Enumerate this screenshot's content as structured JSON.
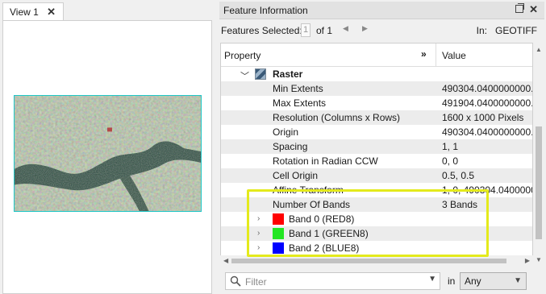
{
  "view": {
    "tab_label": "View 1",
    "close_glyph": "✕"
  },
  "feature_info": {
    "title": "Feature Information",
    "close_glyph": "✕",
    "features_selected_label": "Features Selected:",
    "features_selected_value": "1",
    "of_label": "of 1",
    "in_label": "In:",
    "in_value": "GEOTIFF"
  },
  "table": {
    "col_property": "Property",
    "col_expand": "»",
    "col_value": "Value",
    "group": {
      "label": "Raster"
    },
    "rows": [
      {
        "key": "Min Extents",
        "value": "490304.0400000000..."
      },
      {
        "key": "Max Extents",
        "value": "491904.0400000000..."
      },
      {
        "key": "Resolution (Columns x Rows)",
        "value": "1600 x 1000 Pixels"
      },
      {
        "key": "Origin",
        "value": "490304.0400000000..."
      },
      {
        "key": "Spacing",
        "value": "1, 1"
      },
      {
        "key": "Rotation in Radian CCW",
        "value": "0, 0"
      },
      {
        "key": "Cell Origin",
        "value": "0.5, 0.5"
      },
      {
        "key": "Affine Transform",
        "value": "1, 0, 490304.0400000"
      },
      {
        "key": "Number Of Bands",
        "value": "3 Bands"
      }
    ],
    "bands": [
      {
        "label": "Band 0 (RED8)",
        "color": "#ff0000"
      },
      {
        "label": "Band 1 (GREEN8)",
        "color": "#22e622"
      },
      {
        "label": "Band 2 (BLUE8)",
        "color": "#0000ff"
      }
    ]
  },
  "filter": {
    "placeholder": "Filter",
    "in_label": "in",
    "scope_value": "Any"
  },
  "colors": {
    "highlight": "#e4ea1c",
    "raster_border": "#1fc7c7"
  }
}
